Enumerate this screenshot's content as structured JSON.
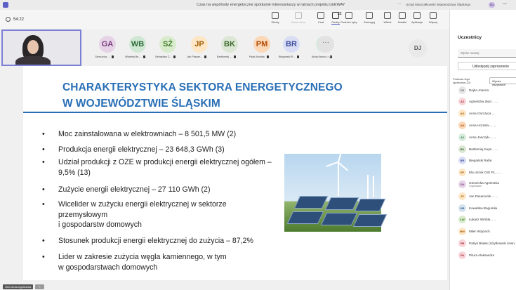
{
  "window": {
    "title": "Czas na wspólnoty energetyczne spotkanie interesariuszy w ramach projektu LEEWAY",
    "account": "Urząd Marszałkowski Województwa Śląskiego",
    "account_initials": "SU",
    "more": "···",
    "minimize": "—"
  },
  "toolbar": {
    "timer": "54:22",
    "buttons": [
      {
        "label": "Skróty",
        "disabled": false
      },
      {
        "label": "Nowe okno",
        "disabled": true
      },
      {
        "label": "Czat",
        "disabled": false
      },
      {
        "label": "Osoby",
        "disabled": false,
        "active": true,
        "count": "22"
      },
      {
        "label": "Podnieś rękę",
        "disabled": false
      },
      {
        "label": "Zareaguj",
        "disabled": false
      },
      {
        "label": "Widok",
        "disabled": false
      },
      {
        "label": "Notatki",
        "disabled": false
      },
      {
        "label": "Aplikacje",
        "disabled": false
      },
      {
        "label": "Więcej",
        "disabled": false
      },
      {
        "label": "Kamera",
        "disabled": true
      },
      {
        "label": "Mikrofon",
        "disabled": true
      },
      {
        "label": "Udostępnij",
        "disabled": false
      }
    ]
  },
  "participants": [
    {
      "initials": "GA",
      "name": "Gierożcka ...",
      "color": "#e6d3e7",
      "text": "#7a3d7c"
    },
    {
      "initials": "WB",
      "name": "Wioletta Be...",
      "color": "#cfe7d3",
      "text": "#2d6b39"
    },
    {
      "initials": "SŻ",
      "name": "Sebastian Ż...",
      "color": "#d8eccd",
      "text": "#3f7a25"
    },
    {
      "initials": "JP",
      "name": "Jan Pasam...",
      "color": "#fde7c7",
      "text": "#a35b00"
    },
    {
      "initials": "BK",
      "name": "Bartłomiej ...",
      "color": "#dbe7d4",
      "text": "#3d6b2e"
    },
    {
      "initials": "PM",
      "name": "Psak Monika",
      "color": "#fbd8b8",
      "text": "#b04a00"
    },
    {
      "initials": "BR",
      "name": "Biegański R...",
      "color": "#d9def5",
      "text": "#3c4a99"
    },
    {
      "initials": "AJ",
      "name": "Anna Jancz...",
      "color": "#d6ecdd",
      "text": "#2c6e45"
    }
  ],
  "more_label": "Wyświetl wszys...",
  "more_glyph": "···",
  "dj": "DJ",
  "slide": {
    "title_line1": "CHARAKTERYSTYKA SEKTORA ENERGETYCZNEGO",
    "title_line2": "W WOJEWÓDZTWIE ŚLĄSKIM",
    "bullets": [
      [
        "Moc zainstalowana w elektrowniach – 8 501,5 MW (2)"
      ],
      [
        "Produkcja energii elektrycznej – 23 648,3 GWh (3)"
      ],
      [
        "Udział produkcji z OZE w produkcji energii elektrycznej ogółem –",
        "9,5% (13)"
      ],
      [
        "Zużycie energii elektrycznej – 27 110 GWh (2)"
      ],
      [
        "Wicelider w zużyciu energii elektrycznej w sektorze",
        "przemysłowym",
        "i gospodarstw domowych"
      ],
      [
        "Stosunek produkcji energii elektrycznej do zużycia – 87,2%"
      ],
      [
        "Lider w zakresie zużycia węgla kamiennego, w tym",
        "w gospodarstwach domowych"
      ]
    ]
  },
  "status": {
    "presenter": "Gierożcka Agnieszka",
    "extra": "+"
  },
  "panel": {
    "title": "Uczestnicy",
    "search_placeholder": "Wpisz nazwę",
    "share_invite": "Udostępnij zaproszenie",
    "section": "Podczas tego spotkania (22)",
    "mute_all": "Wycisz wszystkich",
    "people": [
      {
        "initials": "DJ",
        "name": "Dejka Joanna",
        "color": "#e6e6e6",
        "text": "#555"
      },
      {
        "initials": "AZ",
        "name": "Agnieszka Zięci... ...",
        "color": "#f7d5da",
        "text": "#a4262c"
      },
      {
        "initials": "AG",
        "name": "Anna Gorczyca ...",
        "color": "#fde7c7",
        "text": "#a35b00"
      },
      {
        "initials": "AH",
        "name": "Anna Horzela-... ...",
        "color": "#fbd8b8",
        "text": "#b04a00"
      },
      {
        "initials": "AJ",
        "name": "Anna Janczyk-... ...",
        "color": "#d6ecdd",
        "text": "#2c6e45"
      },
      {
        "initials": "BK",
        "name": "Bartłomiej Kups... ...",
        "color": "#dbe7d4",
        "text": "#3d6b2e"
      },
      {
        "initials": "BR",
        "name": "Biegański Rafał",
        "color": "#d9def5",
        "text": "#3c4a99"
      },
      {
        "initials": "EP",
        "name": "Ela Uszok GIG PL... ...",
        "color": "#fde7c7",
        "text": "#a35b00"
      },
      {
        "initials": "GA",
        "name": "Gierożcka Agnieszka",
        "sub": "Organizator",
        "color": "#e6d3e7",
        "text": "#7a3d7c"
      },
      {
        "initials": "JP",
        "name": "Jan Pasamonik ... ...",
        "color": "#fde7c7",
        "text": "#a35b00"
      },
      {
        "initials": "KB",
        "name": "Kowalska Bogumiła",
        "color": "#d5e3ef",
        "text": "#2e5a84"
      },
      {
        "initials": "ŁW",
        "name": "Łukasz Wróble... ...",
        "color": "#d8eccd",
        "text": "#3f7a25"
      },
      {
        "initials": "MW",
        "name": "Miler Wojciech",
        "color": "#fde7c7",
        "text": "#a35b00"
      },
      {
        "initials": "PB",
        "name": "Patryk Białas (Użytkownik zewn...",
        "color": "#f7d5da",
        "text": "#a4262c"
      },
      {
        "initials": "PA",
        "name": "Pitura Aleksandra",
        "color": "#f7d5da",
        "text": "#a4262c"
      }
    ]
  }
}
